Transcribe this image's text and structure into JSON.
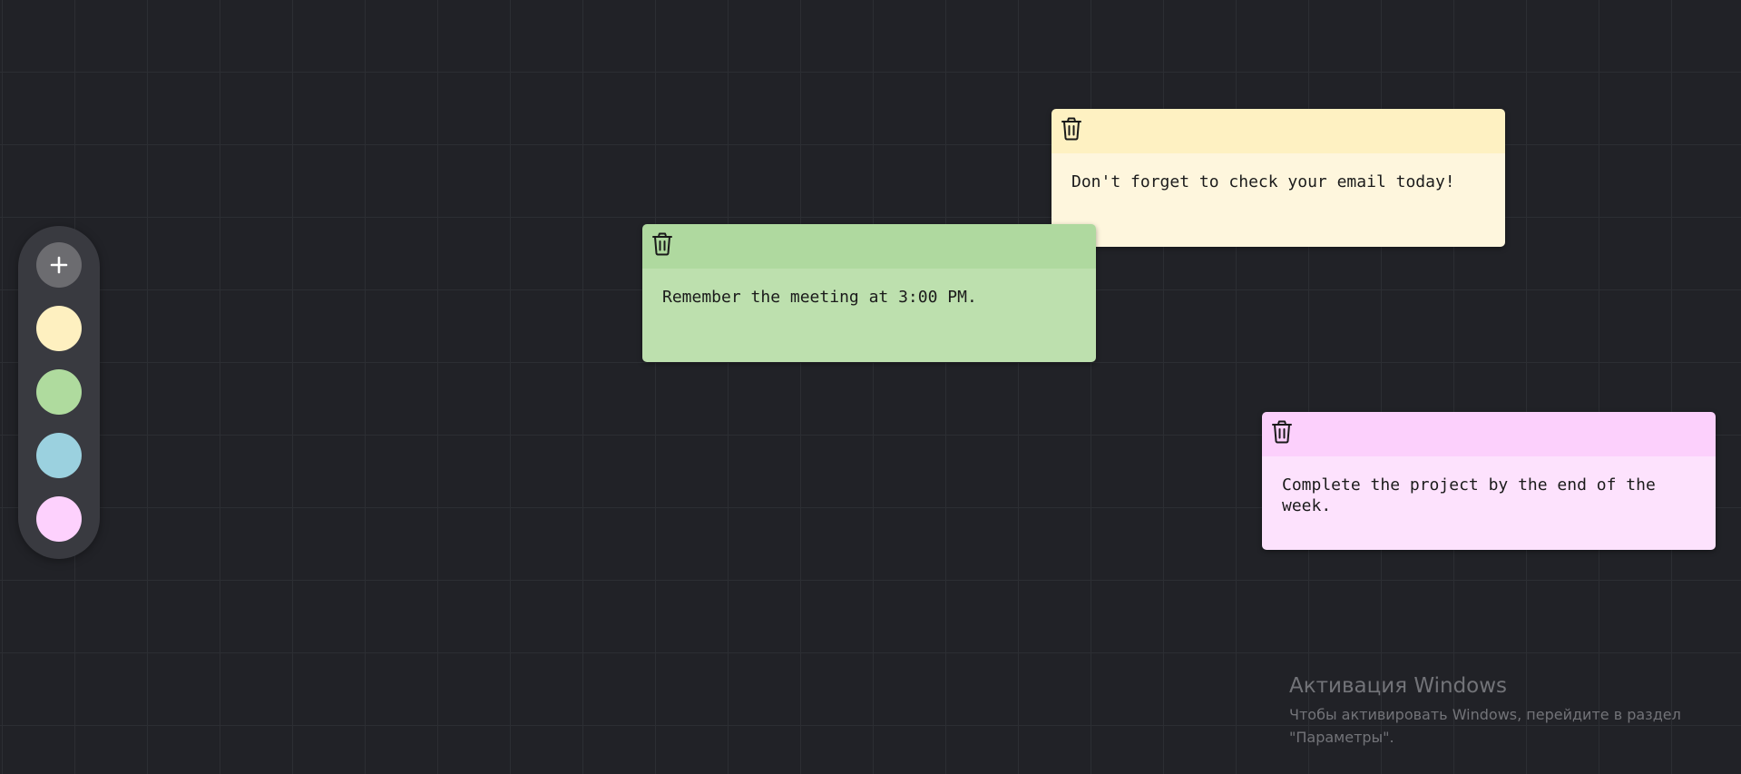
{
  "toolbar": {
    "add_label": "+",
    "add_icon": "plus-icon",
    "swatches": [
      {
        "name": "yellow",
        "color": "#fef0c0"
      },
      {
        "name": "green",
        "color": "#afdb9e"
      },
      {
        "name": "blue",
        "color": "#9bd1df"
      },
      {
        "name": "pink",
        "color": "#fdd1fd"
      }
    ]
  },
  "notes": [
    {
      "header_color": "#fef1c2",
      "body_color": "#fef6dd",
      "delete_icon": "trash-icon",
      "text": "Don't forget to check your email today!"
    },
    {
      "header_color": "#afd99f",
      "body_color": "#bde0ae",
      "delete_icon": "trash-icon",
      "text": "Remember the meeting at 3:00 PM."
    },
    {
      "header_color": "#fcd0fc",
      "body_color": "#fde2fd",
      "delete_icon": "trash-icon",
      "text": "Complete the project by the end of the\nweek."
    }
  ],
  "watermark": {
    "title": "Активация Windows",
    "line1": "Чтобы активировать Windows, перейдите в раздел",
    "line2": "\"Параметры\"."
  }
}
